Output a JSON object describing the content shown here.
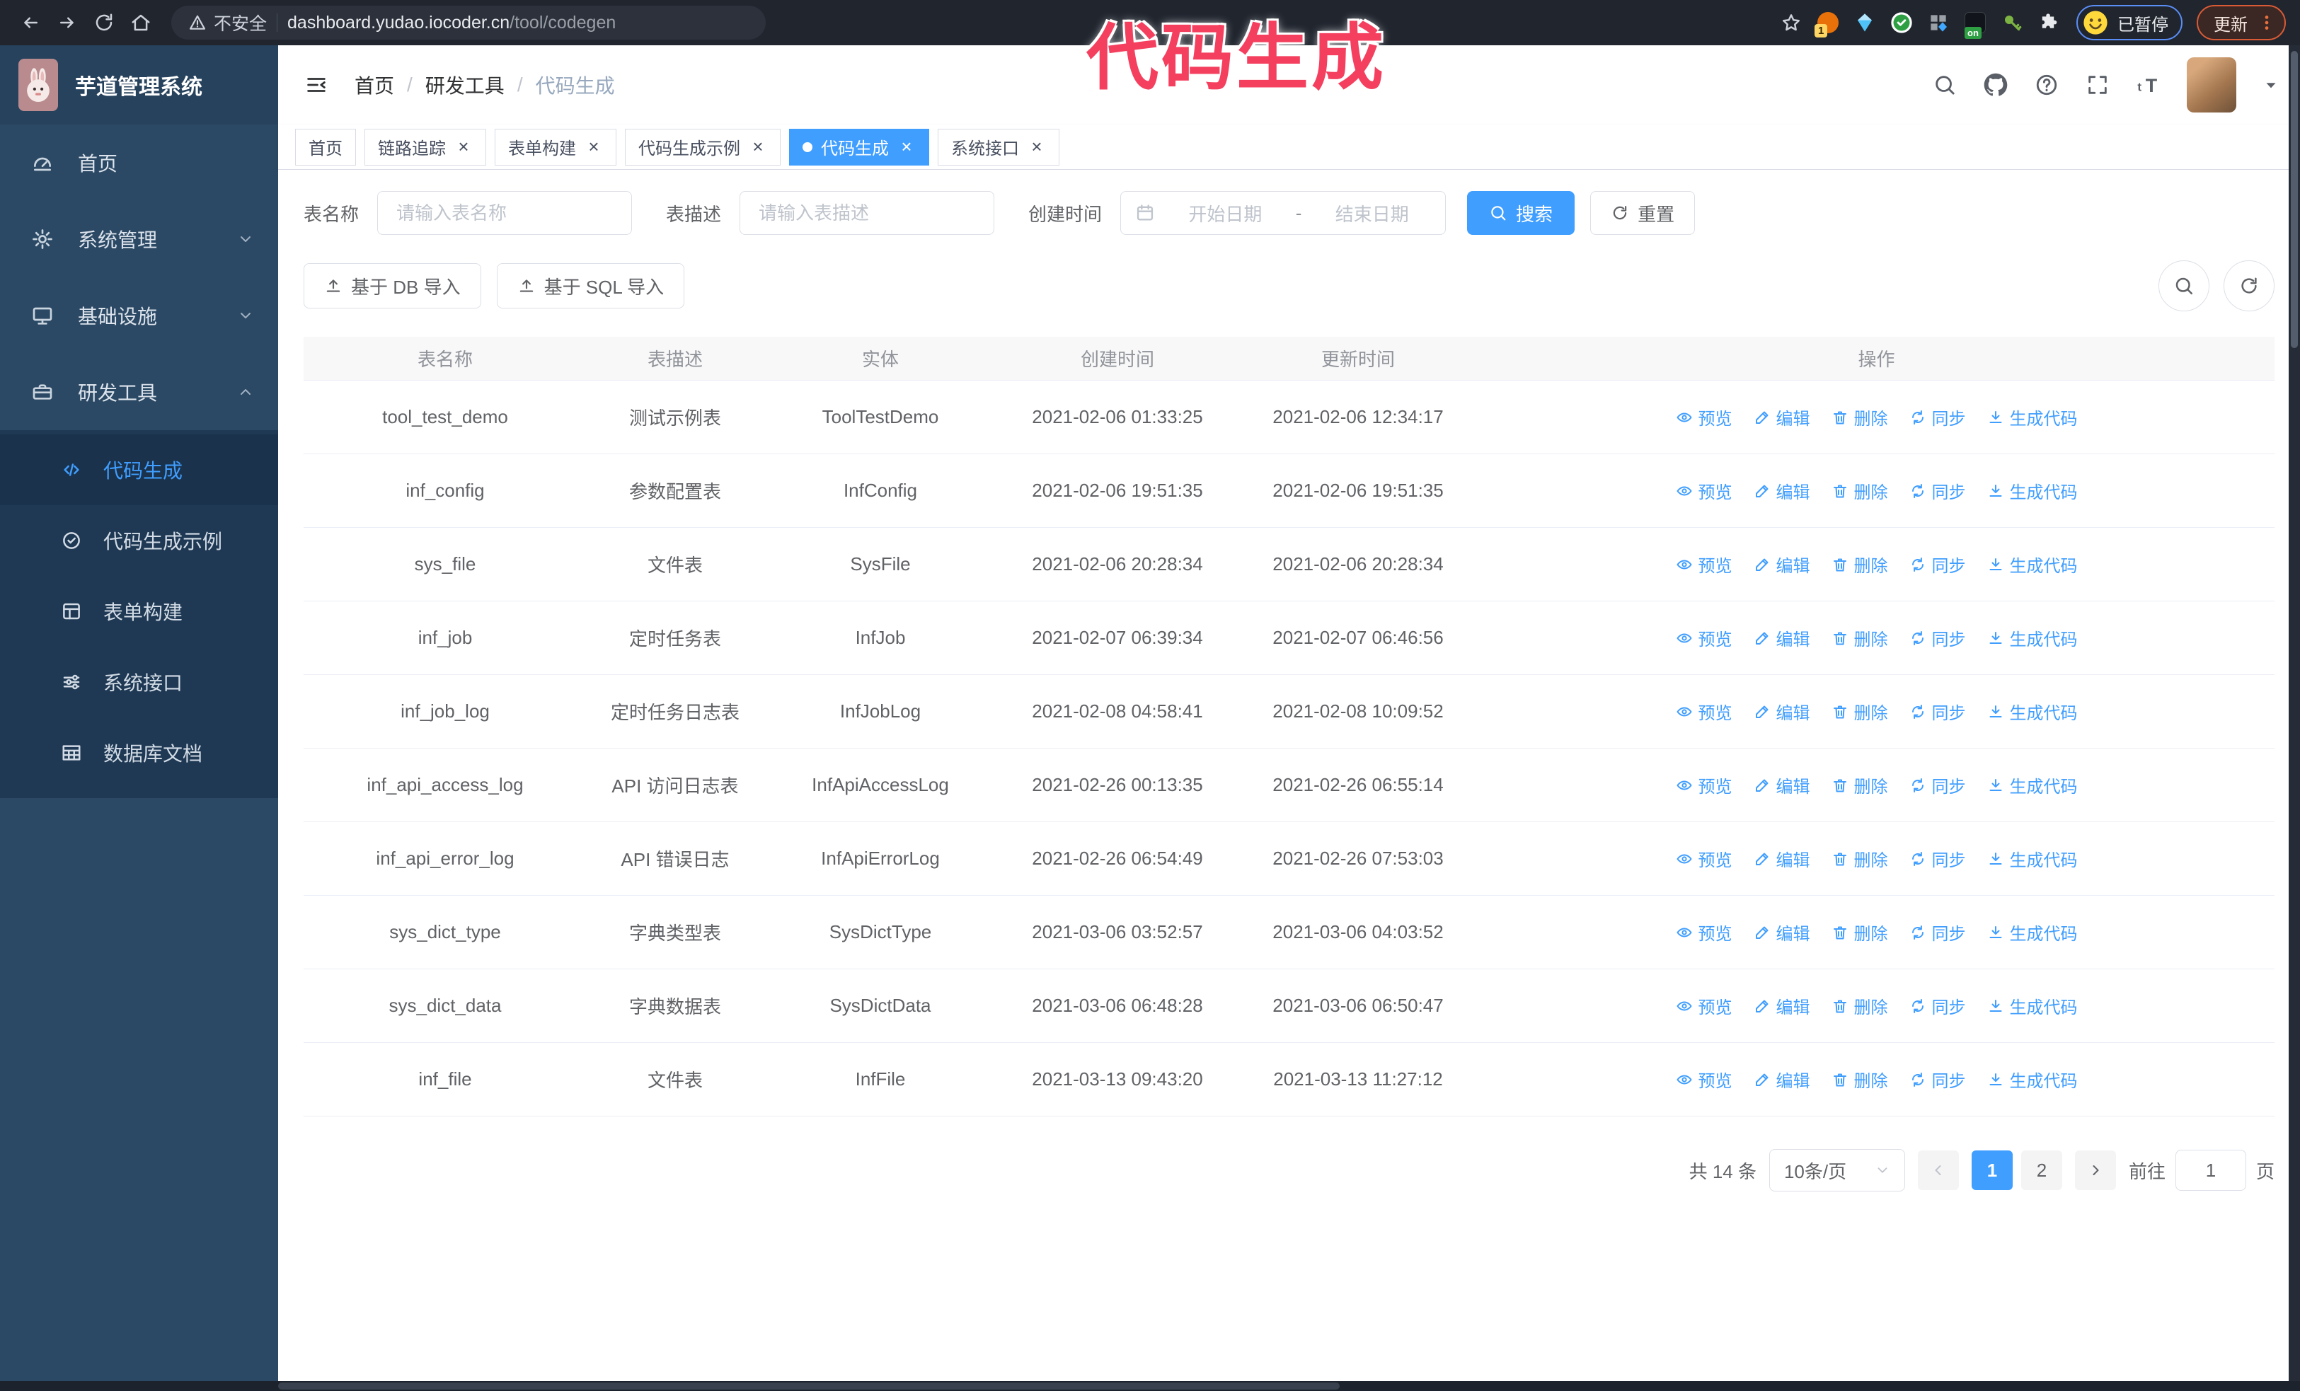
{
  "browser": {
    "security_label": "不安全",
    "url_host": "dashboard.yudao.iocoder.cn",
    "url_path": "/tool/codegen",
    "ext_badge_count": "1",
    "ext_badge_on": "on",
    "profile_status": "已暂停",
    "update_label": "更新"
  },
  "annotation": {
    "text": "代码生成"
  },
  "sidebar": {
    "title": "芋道管理系统",
    "menu": [
      {
        "label": "首页",
        "icon": "dashboard-icon",
        "state": "none",
        "active": false
      },
      {
        "label": "系统管理",
        "icon": "gear-icon",
        "state": "collapsed",
        "active": false
      },
      {
        "label": "基础设施",
        "icon": "monitor-icon",
        "state": "collapsed",
        "active": false
      },
      {
        "label": "研发工具",
        "icon": "toolbox-icon",
        "state": "expanded",
        "active": false
      }
    ],
    "submenu": [
      {
        "label": "代码生成",
        "icon": "code-icon",
        "active": true
      },
      {
        "label": "代码生成示例",
        "icon": "badge-check-icon",
        "active": false
      },
      {
        "label": "表单构建",
        "icon": "form-icon",
        "active": false
      },
      {
        "label": "系统接口",
        "icon": "sliders-icon",
        "active": false
      },
      {
        "label": "数据库文档",
        "icon": "db-table-icon",
        "active": false
      }
    ]
  },
  "header": {
    "breadcrumb": [
      "首页",
      "研发工具",
      "代码生成"
    ]
  },
  "tabs": [
    {
      "label": "首页",
      "closable": false,
      "active": false
    },
    {
      "label": "链路追踪",
      "closable": true,
      "active": false
    },
    {
      "label": "表单构建",
      "closable": true,
      "active": false
    },
    {
      "label": "代码生成示例",
      "closable": true,
      "active": false
    },
    {
      "label": "代码生成",
      "closable": true,
      "active": true
    },
    {
      "label": "系统接口",
      "closable": true,
      "active": false
    }
  ],
  "filters": {
    "name_label": "表名称",
    "name_placeholder": "请输入表名称",
    "desc_label": "表描述",
    "desc_placeholder": "请输入表描述",
    "date_label": "创建时间",
    "date_start_placeholder": "开始日期",
    "date_separator": "-",
    "date_end_placeholder": "结束日期",
    "search_label": "搜索",
    "reset_label": "重置"
  },
  "toolbar": {
    "import_db_label": "基于 DB 导入",
    "import_sql_label": "基于 SQL 导入"
  },
  "table": {
    "columns": [
      "表名称",
      "表描述",
      "实体",
      "创建时间",
      "更新时间",
      "操作"
    ],
    "actions": [
      {
        "label": "预览",
        "icon": "eye-icon"
      },
      {
        "label": "编辑",
        "icon": "edit-icon"
      },
      {
        "label": "删除",
        "icon": "delete-icon"
      },
      {
        "label": "同步",
        "icon": "sync-icon"
      },
      {
        "label": "生成代码",
        "icon": "download-icon"
      }
    ],
    "rows": [
      {
        "name": "tool_test_demo",
        "desc": "测试示例表",
        "entity": "ToolTestDemo",
        "created": "2021-02-06 01:33:25",
        "updated": "2021-02-06 12:34:17"
      },
      {
        "name": "inf_config",
        "desc": "参数配置表",
        "entity": "InfConfig",
        "created": "2021-02-06 19:51:35",
        "updated": "2021-02-06 19:51:35"
      },
      {
        "name": "sys_file",
        "desc": "文件表",
        "entity": "SysFile",
        "created": "2021-02-06 20:28:34",
        "updated": "2021-02-06 20:28:34"
      },
      {
        "name": "inf_job",
        "desc": "定时任务表",
        "entity": "InfJob",
        "created": "2021-02-07 06:39:34",
        "updated": "2021-02-07 06:46:56"
      },
      {
        "name": "inf_job_log",
        "desc": "定时任务日志表",
        "entity": "InfJobLog",
        "created": "2021-02-08 04:58:41",
        "updated": "2021-02-08 10:09:52"
      },
      {
        "name": "inf_api_access_log",
        "desc": "API 访问日志表",
        "entity": "InfApiAccessLog",
        "created": "2021-02-26 00:13:35",
        "updated": "2021-02-26 06:55:14"
      },
      {
        "name": "inf_api_error_log",
        "desc": "API 错误日志",
        "entity": "InfApiErrorLog",
        "created": "2021-02-26 06:54:49",
        "updated": "2021-02-26 07:53:03"
      },
      {
        "name": "sys_dict_type",
        "desc": "字典类型表",
        "entity": "SysDictType",
        "created": "2021-03-06 03:52:57",
        "updated": "2021-03-06 04:03:52"
      },
      {
        "name": "sys_dict_data",
        "desc": "字典数据表",
        "entity": "SysDictData",
        "created": "2021-03-06 06:48:28",
        "updated": "2021-03-06 06:50:47"
      },
      {
        "name": "inf_file",
        "desc": "文件表",
        "entity": "InfFile",
        "created": "2021-03-13 09:43:20",
        "updated": "2021-03-13 11:27:12"
      }
    ]
  },
  "pagination": {
    "total": "共 14 条",
    "page_size": "10条/页",
    "pages": [
      "1",
      "2"
    ],
    "active_page": "1",
    "goto_label": "前往",
    "goto_value": "1",
    "goto_suffix": "页"
  },
  "colors": {
    "accent": "#409eff",
    "annotation": "#f43f5e",
    "sidebar_bg": "#2b4964",
    "submenu_bg": "#1f3954",
    "browser_bar_bg": "#20252e"
  }
}
